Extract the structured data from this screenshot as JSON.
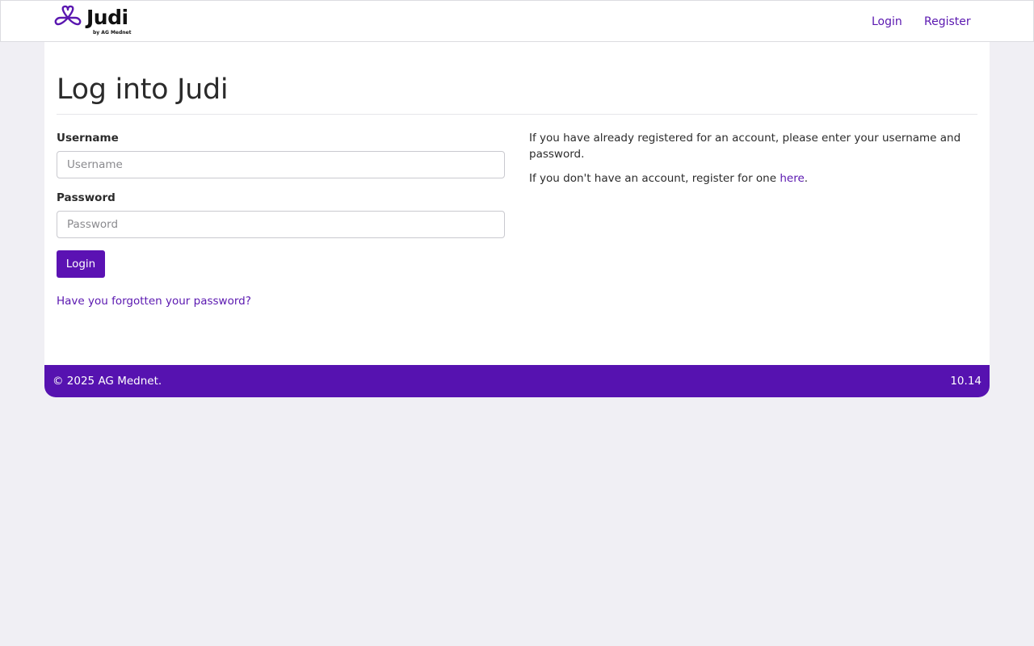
{
  "brand": {
    "name": "Judi",
    "tagline": "by AG Mednet",
    "color": "#5a17b0"
  },
  "nav": {
    "login": "Login",
    "register": "Register"
  },
  "page": {
    "title": "Log into Judi"
  },
  "form": {
    "username_label": "Username",
    "username_placeholder": "Username",
    "username_value": "",
    "password_label": "Password",
    "password_placeholder": "Password",
    "password_value": "",
    "submit": "Login",
    "forgot": "Have you forgotten your password?"
  },
  "info": {
    "registered_text": "If you have already registered for an account, please enter your username and password.",
    "register_prefix": "If you don't have an account, register for one ",
    "register_link": "here",
    "register_suffix": "."
  },
  "footer": {
    "copyright": "© 2025 AG Mednet.",
    "version": "10.14",
    "color": "#5612b0"
  }
}
